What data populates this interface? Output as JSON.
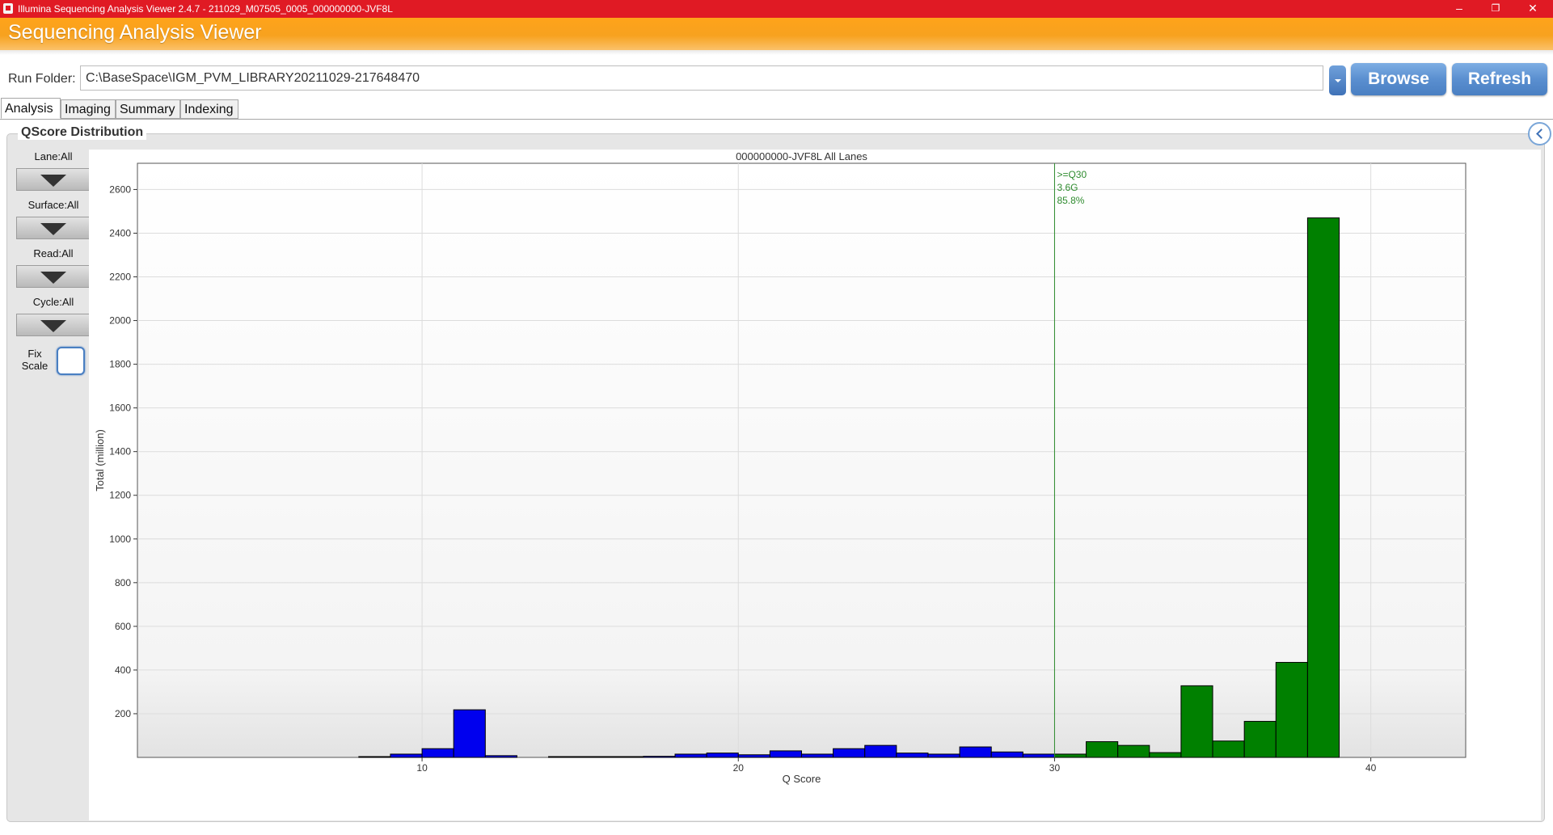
{
  "window": {
    "title": "Illumina Sequencing Analysis Viewer 2.4.7 - 211029_M07505_0005_000000000-JVF8L",
    "minimize": "–",
    "restore": "❐",
    "close": "✕"
  },
  "header": {
    "title": "Sequencing Analysis Viewer"
  },
  "run_folder": {
    "label": "Run Folder:",
    "value": "C:\\BaseSpace\\IGM_PVM_LIBRARY20211029-217648470",
    "browse_label": "Browse",
    "refresh_label": "Refresh"
  },
  "tabs": [
    {
      "label": "Analysis",
      "active": true
    },
    {
      "label": "Imaging",
      "active": false
    },
    {
      "label": "Summary",
      "active": false
    },
    {
      "label": "Indexing",
      "active": false
    }
  ],
  "section": {
    "title": "QScore Distribution"
  },
  "filters": {
    "lane": "Lane:All",
    "surface": "Surface:All",
    "read": "Read:All",
    "cycle": "Cycle:All",
    "fix_scale": "Fix Scale",
    "fix_scale_checked": false
  },
  "colors": {
    "below_q30": "#0000ee",
    "above_q30": "#008000",
    "threshold_line": "#2e8b2e",
    "brand_red": "#e01a24",
    "brand_orange": "#f7a21f"
  },
  "chart_data": {
    "type": "bar",
    "title": "000000000-JVF8L All Lanes",
    "xlabel": "Q Score",
    "ylabel": "Total (million)",
    "xlim": [
      1,
      43
    ],
    "ylim": [
      0,
      2720
    ],
    "xticks": [
      10,
      20,
      30,
      40
    ],
    "yticks": [
      200,
      400,
      600,
      800,
      1000,
      1200,
      1400,
      1600,
      1800,
      2000,
      2200,
      2400,
      2600
    ],
    "grid": true,
    "threshold": {
      "q": 30,
      "lines": [
        ">=Q30",
        "3.6G",
        "85.8%"
      ]
    },
    "bars": [
      {
        "q": 8,
        "value": 3
      },
      {
        "q": 9,
        "value": 15
      },
      {
        "q": 10,
        "value": 40
      },
      {
        "q": 11,
        "value": 218
      },
      {
        "q": 12,
        "value": 8
      },
      {
        "q": 14,
        "value": 2
      },
      {
        "q": 15,
        "value": 2
      },
      {
        "q": 16,
        "value": 2
      },
      {
        "q": 17,
        "value": 5
      },
      {
        "q": 18,
        "value": 15
      },
      {
        "q": 19,
        "value": 20
      },
      {
        "q": 20,
        "value": 12
      },
      {
        "q": 21,
        "value": 30
      },
      {
        "q": 22,
        "value": 15
      },
      {
        "q": 23,
        "value": 40
      },
      {
        "q": 24,
        "value": 55
      },
      {
        "q": 25,
        "value": 20
      },
      {
        "q": 26,
        "value": 15
      },
      {
        "q": 27,
        "value": 48
      },
      {
        "q": 28,
        "value": 25
      },
      {
        "q": 29,
        "value": 15
      },
      {
        "q": 30,
        "value": 15
      },
      {
        "q": 31,
        "value": 72
      },
      {
        "q": 32,
        "value": 55
      },
      {
        "q": 33,
        "value": 22
      },
      {
        "q": 34,
        "value": 328
      },
      {
        "q": 35,
        "value": 75
      },
      {
        "q": 36,
        "value": 165
      },
      {
        "q": 37,
        "value": 435
      },
      {
        "q": 38,
        "value": 2470
      }
    ]
  }
}
